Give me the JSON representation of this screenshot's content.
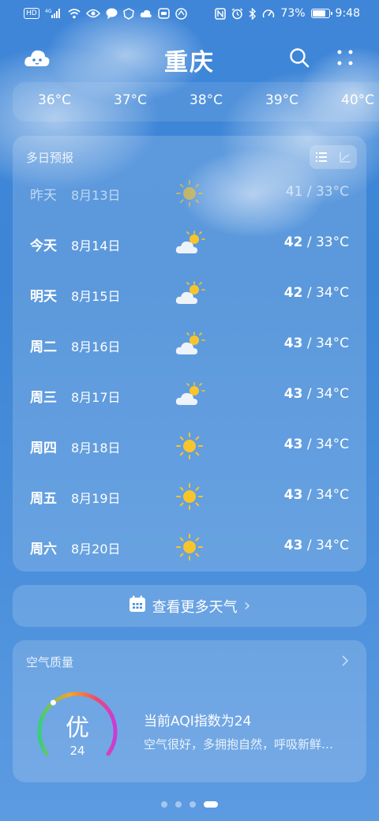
{
  "status_bar": {
    "time": "9:48",
    "battery_percent": "73%",
    "network": "4G",
    "left_icons": [
      "nfc-icon",
      "signal-icon",
      "wifi-icon",
      "eye-icon",
      "message-icon",
      "shield-icon",
      "cloud-icon",
      "app-icon",
      "huawei-icon"
    ],
    "right_icons": [
      "nfc-icon",
      "alarm-icon",
      "bluetooth-icon",
      "speed-icon",
      "battery-icon"
    ]
  },
  "header": {
    "city": "重庆",
    "left_icon": "weather-avatar-icon",
    "right_icons": [
      "search-icon",
      "more-grid-icon"
    ]
  },
  "hourly": {
    "temps": [
      "36°C",
      "37°C",
      "38°C",
      "39°C",
      "40°C"
    ]
  },
  "forecast": {
    "title": "多日预报",
    "view_modes": [
      "list-view-icon",
      "chart-view-icon"
    ],
    "days": [
      {
        "name": "昨天",
        "date": "8月13日",
        "icon": "sunny",
        "high": "41",
        "sep": " / ",
        "low": "33°C",
        "past": true
      },
      {
        "name": "今天",
        "date": "8月14日",
        "icon": "partly-cloudy",
        "high": "42",
        "sep": " / ",
        "low": "33°C",
        "past": false
      },
      {
        "name": "明天",
        "date": "8月15日",
        "icon": "partly-cloudy",
        "high": "42",
        "sep": " / ",
        "low": "34°C",
        "past": false
      },
      {
        "name": "周二",
        "date": "8月16日",
        "icon": "partly-cloudy",
        "high": "43",
        "sep": " / ",
        "low": "34°C",
        "past": false
      },
      {
        "name": "周三",
        "date": "8月17日",
        "icon": "partly-cloudy",
        "high": "43",
        "sep": " / ",
        "low": "34°C",
        "past": false
      },
      {
        "name": "周四",
        "date": "8月18日",
        "icon": "sunny",
        "high": "43",
        "sep": " / ",
        "low": "34°C",
        "past": false
      },
      {
        "name": "周五",
        "date": "8月19日",
        "icon": "sunny",
        "high": "43",
        "sep": " / ",
        "low": "34°C",
        "past": false
      },
      {
        "name": "周六",
        "date": "8月20日",
        "icon": "sunny",
        "high": "43",
        "sep": " / ",
        "low": "34°C",
        "past": false
      }
    ]
  },
  "more_weather": {
    "label": "查看更多天气",
    "arrow": "›"
  },
  "air_quality": {
    "title": "空气质量",
    "level": "优",
    "aqi_value": "24",
    "headline": "当前AQI指数为24",
    "description": "空气很好，多拥抱自然，呼吸新鲜…",
    "gauge_fraction": 0.05
  },
  "pager": {
    "count": 4,
    "active_index": 3
  },
  "colors": {
    "sun": "#f7c52b",
    "cloud": "#eef3fa",
    "gauge_start": "#35d07a",
    "gauge_mid": "#f6a623",
    "gauge_end": "#c93bd9"
  }
}
